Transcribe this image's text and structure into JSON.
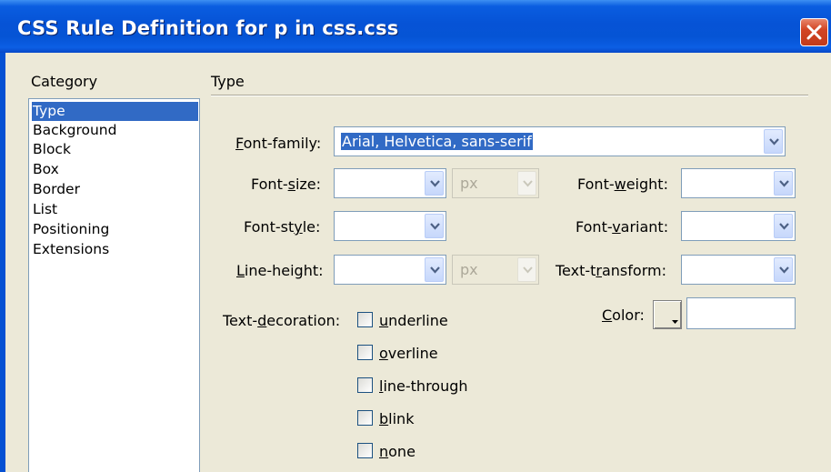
{
  "window": {
    "title": "CSS Rule Definition for p in css.css"
  },
  "category": {
    "header": "Category",
    "items": [
      "Type",
      "Background",
      "Block",
      "Box",
      "Border",
      "List",
      "Positioning",
      "Extensions"
    ],
    "selected": "Type"
  },
  "panel": {
    "header": "Type"
  },
  "fields": {
    "font_family": {
      "label_pre": "",
      "label_key": "F",
      "label_post": "ont-family:",
      "value": "Arial, Helvetica, sans-serif"
    },
    "font_size": {
      "label_pre": "Font-",
      "label_key": "s",
      "label_post": "ize:",
      "value": "",
      "unit": "px"
    },
    "font_style": {
      "label_pre": "Font-st",
      "label_key": "y",
      "label_post": "le:",
      "value": ""
    },
    "line_height": {
      "label_pre": "",
      "label_key": "L",
      "label_post": "ine-height:",
      "value": "",
      "unit": "px"
    },
    "font_weight": {
      "label_pre": "Font-",
      "label_key": "w",
      "label_post": "eight:",
      "value": ""
    },
    "font_variant": {
      "label_pre": "Font-",
      "label_key": "v",
      "label_post": "ariant:",
      "value": ""
    },
    "text_transform": {
      "label_pre": "Text-t",
      "label_key": "r",
      "label_post": "ansform:",
      "value": ""
    },
    "color": {
      "label_pre": "",
      "label_key": "C",
      "label_post": "olor:",
      "value": ""
    }
  },
  "text_decoration": {
    "label_pre": "Text-",
    "label_key": "d",
    "label_post": "ecoration:",
    "options": [
      {
        "key": "u",
        "rest": "nderline",
        "checked": false
      },
      {
        "key": "o",
        "rest": "verline",
        "checked": false
      },
      {
        "key": "l",
        "rest": "ine-through",
        "checked": false
      },
      {
        "key": "b",
        "rest": "link",
        "checked": false
      },
      {
        "key": "n",
        "rest": "one",
        "checked": false
      }
    ]
  },
  "icons": {
    "close": "close-x-icon",
    "dropdown": "chevron-down-icon",
    "color_picker": "color-picker-arrow-icon"
  },
  "colors": {
    "titlebar": "#0554d5",
    "selection": "#316ac5",
    "dialog_bg": "#ece9d8",
    "close_button": "#c23b1b"
  }
}
